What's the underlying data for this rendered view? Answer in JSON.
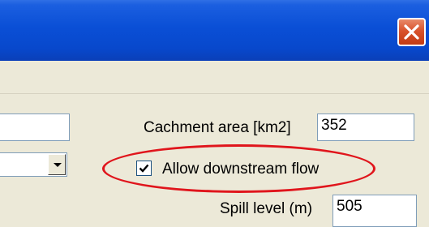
{
  "window": {
    "titlebar_color": "#0a4fd6",
    "close_icon": "close-icon",
    "close_color": "#d9532c"
  },
  "form": {
    "catchment_label": "Cachment area [km2]",
    "catchment_value": "352",
    "allow_downstream_label": "Allow downstream  flow",
    "allow_downstream_checked": true,
    "spill_label": "Spill level (m)",
    "spill_value": "505",
    "left_text_value": "",
    "left_dropdown_value": ""
  },
  "annotation": {
    "ellipse_color": "#e0151c"
  }
}
